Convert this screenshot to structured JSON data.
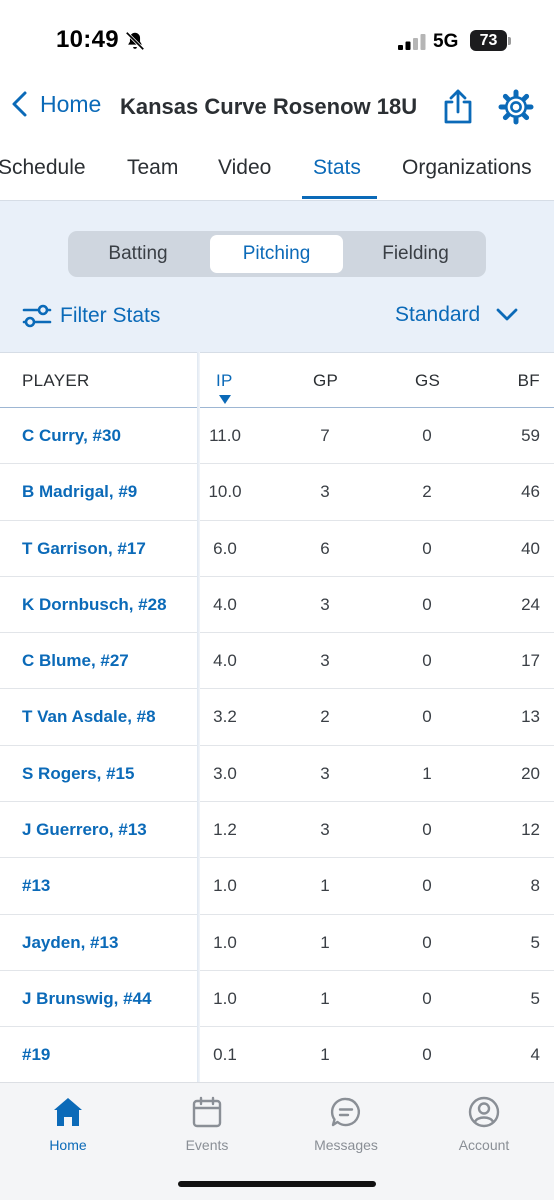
{
  "status_bar": {
    "time": "10:49",
    "network": "5G",
    "battery": "73"
  },
  "nav": {
    "back_label": "Home",
    "title": "Kansas Curve Rosenow 18U"
  },
  "tabs": [
    "Schedule",
    "Team",
    "Video",
    "Stats",
    "Organizations"
  ],
  "active_tab": "Stats",
  "segments": [
    "Batting",
    "Pitching",
    "Fielding"
  ],
  "active_segment": "Pitching",
  "filter_label": "Filter Stats",
  "view_select": "Standard",
  "columns": [
    "PLAYER",
    "IP",
    "GP",
    "GS",
    "BF"
  ],
  "sorted_column": "IP",
  "rows": [
    {
      "player": "C Curry, #30",
      "ip": "11.0",
      "gp": "7",
      "gs": "0",
      "bf": "59"
    },
    {
      "player": "B Madrigal, #9",
      "ip": "10.0",
      "gp": "3",
      "gs": "2",
      "bf": "46"
    },
    {
      "player": "T Garrison, #17",
      "ip": "6.0",
      "gp": "6",
      "gs": "0",
      "bf": "40"
    },
    {
      "player": "K Dornbusch, #28",
      "ip": "4.0",
      "gp": "3",
      "gs": "0",
      "bf": "24"
    },
    {
      "player": "C Blume, #27",
      "ip": "4.0",
      "gp": "3",
      "gs": "0",
      "bf": "17"
    },
    {
      "player": "T Van Asdale, #8",
      "ip": "3.2",
      "gp": "2",
      "gs": "0",
      "bf": "13"
    },
    {
      "player": "S Rogers, #15",
      "ip": "3.0",
      "gp": "3",
      "gs": "1",
      "bf": "20"
    },
    {
      "player": "J Guerrero, #13",
      "ip": "1.2",
      "gp": "3",
      "gs": "0",
      "bf": "12"
    },
    {
      "player": "#13",
      "ip": "1.0",
      "gp": "1",
      "gs": "0",
      "bf": "8"
    },
    {
      "player": "Jayden, #13",
      "ip": "1.0",
      "gp": "1",
      "gs": "0",
      "bf": "5"
    },
    {
      "player": "J Brunswig, #44",
      "ip": "1.0",
      "gp": "1",
      "gs": "0",
      "bf": "5"
    },
    {
      "player": "#19",
      "ip": "0.1",
      "gp": "1",
      "gs": "0",
      "bf": "4"
    }
  ],
  "tabbar": [
    "Home",
    "Events",
    "Messages",
    "Account"
  ],
  "active_tabbar": "Home",
  "colors": {
    "accent": "#0b6ab8",
    "stats_bg": "#e9f0f9"
  },
  "icons": [
    "bell-slash-icon",
    "signal-icon",
    "chevron-left-icon",
    "share-icon",
    "gear-icon",
    "filter-sliders-icon",
    "chevron-down-icon",
    "sort-down-icon",
    "home-icon",
    "calendar-icon",
    "chat-icon",
    "account-icon"
  ]
}
